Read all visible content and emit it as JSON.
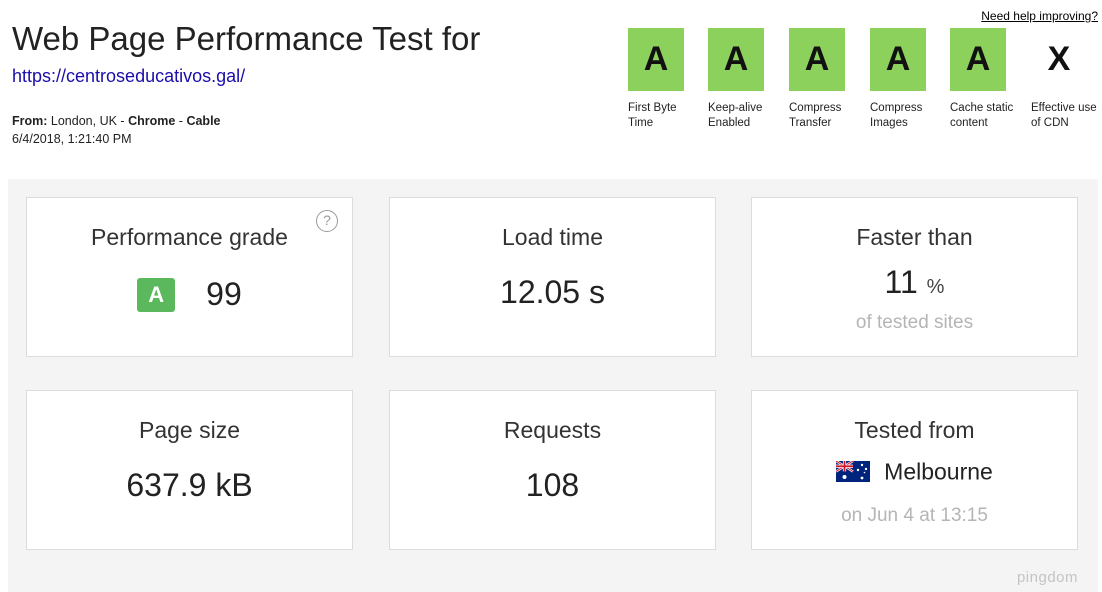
{
  "header": {
    "title": "Web Page Performance Test for",
    "url": "https://centroseducativos.gal/",
    "from_label": "From:",
    "location": "London, UK",
    "separator": "-",
    "browser": "Chrome",
    "connection": "Cable",
    "datetime": "6/4/2018, 1:21:40 PM",
    "help_link": "Need help improving?"
  },
  "grades": [
    {
      "grade": "A",
      "caption": "First Byte Time",
      "status": "pass"
    },
    {
      "grade": "A",
      "caption": "Keep-alive Enabled",
      "status": "pass"
    },
    {
      "grade": "A",
      "caption": "Compress Transfer",
      "status": "pass"
    },
    {
      "grade": "A",
      "caption": "Compress Images",
      "status": "pass"
    },
    {
      "grade": "A",
      "caption": "Cache static content",
      "status": "pass"
    },
    {
      "grade": "X",
      "caption": "Effective use of CDN",
      "status": "none"
    }
  ],
  "stats": {
    "performance": {
      "title": "Performance grade",
      "help": "?",
      "grade": "A",
      "score": "99"
    },
    "load_time": {
      "title": "Load time",
      "value": "12.05 s"
    },
    "faster_than": {
      "title": "Faster than",
      "value": "11",
      "unit": "%",
      "sub": "of tested sites"
    },
    "page_size": {
      "title": "Page size",
      "value": "637.9 kB"
    },
    "requests": {
      "title": "Requests",
      "value": "108"
    },
    "tested_from": {
      "title": "Tested from",
      "location": "Melbourne",
      "flag": "australia-flag",
      "sub": "on Jun 4 at 13:15"
    }
  },
  "brand": "pingdom",
  "colors": {
    "grade_pass": "#8cd15c",
    "badge": "#5cb85c",
    "link": "#1a0dab"
  }
}
